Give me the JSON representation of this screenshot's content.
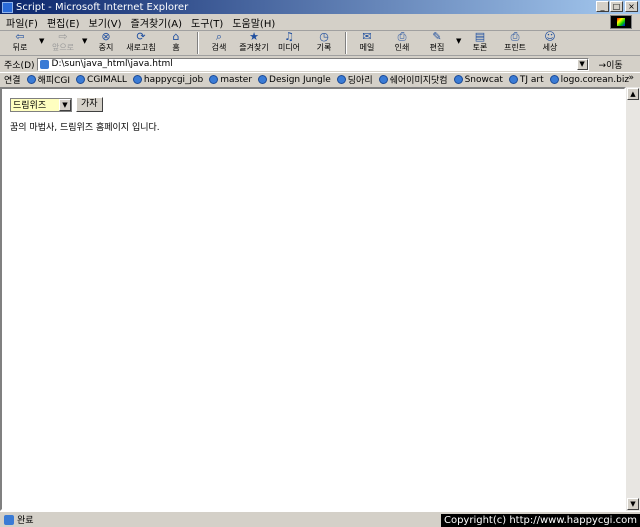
{
  "window": {
    "title": "Script - Microsoft Internet Explorer",
    "minimize": "_",
    "maximize": "□",
    "close": "×"
  },
  "menu": [
    "파일(F)",
    "편집(E)",
    "보기(V)",
    "즐겨찾기(A)",
    "도구(T)",
    "도움말(H)"
  ],
  "toolbar": {
    "back": "뒤로",
    "forward": "앞으로",
    "stop": "중지",
    "refresh": "새로고침",
    "home": "홈",
    "search": "검색",
    "favorites": "즐겨찾기",
    "media": "미디어",
    "history": "기록",
    "mail": "메일",
    "print": "인쇄",
    "edit": "편집",
    "discuss": "토론",
    "print2": "프린트",
    "messenger": "세상"
  },
  "address": {
    "label": "주소(D)",
    "value": "D:\\sun\\java_html\\java.html",
    "go": "이동"
  },
  "links": {
    "label": "연결",
    "items": [
      "해피CGI",
      "CGIMALL",
      "happycgi_job",
      "master",
      "Design Jungle",
      "딩아리",
      "쉐어이미지닷컴",
      "Snowcat",
      "TJ art",
      "logo.corean.biz"
    ],
    "more": "»"
  },
  "page": {
    "select_value": "드림위즈",
    "go_button": "가자",
    "message": "꿈의 마법사, 드림위즈 홈페이지 입니다."
  },
  "status": {
    "text": "완료",
    "copyright": "Copyright(c) http://www.happycgi.com"
  }
}
